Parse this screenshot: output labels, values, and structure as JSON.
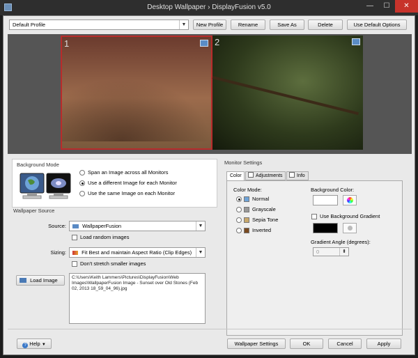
{
  "window": {
    "title": "Desktop Wallpaper › DisplayFusion v5.0",
    "min_label": "—",
    "max_label": "☐",
    "close_label": "✕"
  },
  "toolbar": {
    "profile": "Default Profile",
    "new_profile": "New Profile",
    "rename": "Rename",
    "save_as": "Save As",
    "delete": "Delete",
    "use_default": "Use Default Options"
  },
  "preview": {
    "monitor1_number": "1",
    "monitor2_number": "2"
  },
  "background_mode": {
    "title": "Background Mode",
    "options": [
      "Span an Image across all Monitors",
      "Use a different Image for each Monitor",
      "Use the same Image on each Monitor"
    ],
    "selected_index": 1
  },
  "wallpaper_source": {
    "title": "Wallpaper Source",
    "source_label": "Source:",
    "source_value": "WallpaperFusion",
    "load_random": "Load random images",
    "sizing_label": "Sizing:",
    "sizing_value": "Fit Best and maintain Aspect Ratio (Clip Edges)",
    "dont_stretch": "Don't stretch smaller images",
    "load_image": "Load Image",
    "path_text": "C:\\Users\\Keith Lammers\\Pictures\\DisplayFusion\\Web Images\\WallpaperFusion Image - Sunset over Old Stones (Feb 02, 2013 18_59_04_96).jpg"
  },
  "monitor_settings": {
    "title": "Monitor Settings",
    "tabs": [
      "Color",
      "Adjustments",
      "Info"
    ],
    "color_mode_label": "Color Mode:",
    "modes": [
      "Normal",
      "Grayscale",
      "Sepia Tone",
      "Inverted"
    ],
    "selected_mode_index": 0,
    "bg_color_label": "Background Color:",
    "use_gradient": "Use Background Gradient",
    "gradient_angle_label": "Gradient Angle (degrees):",
    "gradient_angle_value": "0"
  },
  "footer": {
    "help": "Help",
    "wallpaper_settings": "Wallpaper Settings",
    "ok": "OK",
    "cancel": "Cancel",
    "apply": "Apply"
  },
  "colors": {
    "selected_monitor_border": "#b92b2b",
    "background_color": "#ffffff",
    "gradient_color": "#000000"
  }
}
